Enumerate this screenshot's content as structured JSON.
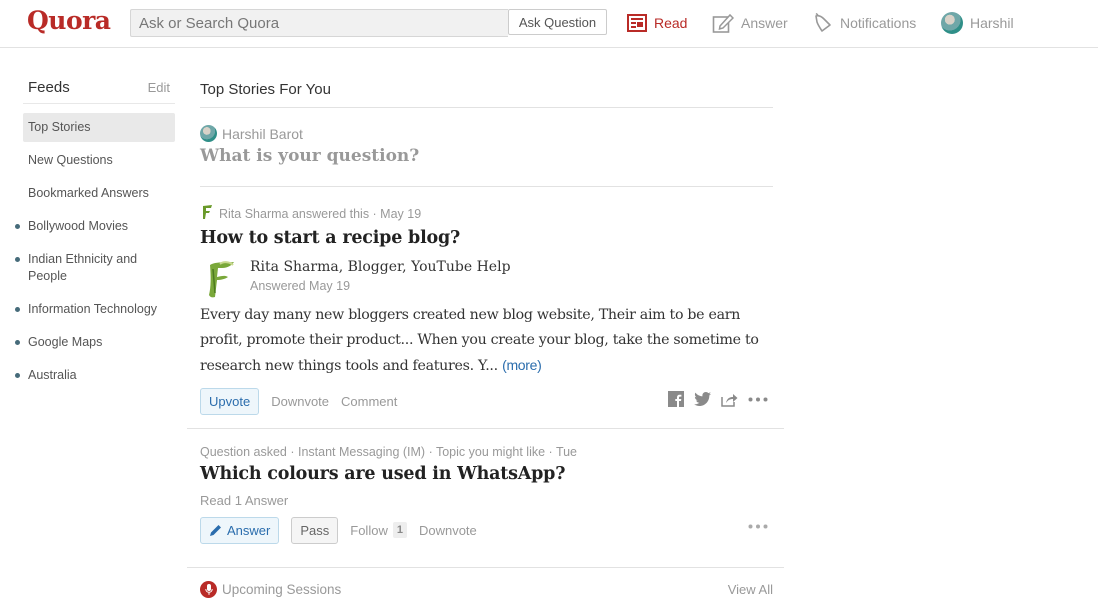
{
  "header": {
    "logo": "Quora",
    "search_placeholder": "Ask or Search Quora",
    "ask_button": "Ask Question",
    "nav": [
      {
        "label": "Read",
        "icon": "read-icon",
        "active": true
      },
      {
        "label": "Answer",
        "icon": "answer-icon",
        "active": false
      },
      {
        "label": "Notifications",
        "icon": "bell-icon",
        "active": false
      },
      {
        "label": "Harshil",
        "icon": "avatar",
        "active": false
      }
    ],
    "accent_color": "#b92b27"
  },
  "sidebar": {
    "title": "Feeds",
    "edit_label": "Edit",
    "items": [
      {
        "label": "Top Stories",
        "active": true,
        "topic": false
      },
      {
        "label": "New Questions",
        "active": false,
        "topic": false
      },
      {
        "label": "Bookmarked Answers",
        "active": false,
        "topic": false
      },
      {
        "label": "Bollywood Movies",
        "active": false,
        "topic": true
      },
      {
        "label": "Indian Ethnicity and People",
        "active": false,
        "topic": true
      },
      {
        "label": "Information Technology",
        "active": false,
        "topic": true
      },
      {
        "label": "Google Maps",
        "active": false,
        "topic": true
      },
      {
        "label": "Australia",
        "active": false,
        "topic": true
      }
    ]
  },
  "main": {
    "title": "Top Stories For You",
    "ask_box": {
      "user": "Harshil Barot",
      "prompt": "What is your question?"
    },
    "stories": [
      {
        "meta": "Rita Sharma answered this · May 19",
        "question": "How to start a recipe blog?",
        "author": "Rita Sharma, Blogger, YouTube Help",
        "answered": "Answered May 19",
        "body": "Every day many new bloggers created new blog website, Their aim to be earn profit, promote their product... When you create your blog, take the sometime to research new things tools and features. Y...",
        "more": "(more)",
        "actions": {
          "upvote": "Upvote",
          "downvote": "Downvote",
          "comment": "Comment"
        }
      },
      {
        "meta": "Question asked · Instant Messaging (IM) · Topic you might like · Tue",
        "question": "Which colours are used in WhatsApp?",
        "read_answers": "Read 1 Answer",
        "actions": {
          "answer": "Answer",
          "pass": "Pass",
          "follow": "Follow",
          "follow_count": "1",
          "downvote": "Downvote"
        }
      }
    ],
    "sessions": {
      "label": "Upcoming Sessions",
      "view_all": "View All"
    }
  }
}
